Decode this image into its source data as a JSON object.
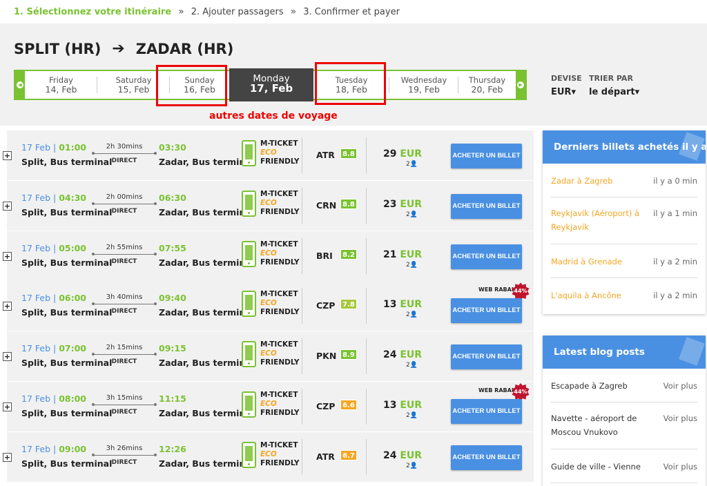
{
  "steps": [
    "1. Sélectionnez votre itinéraire",
    "2. Ajouter passagers",
    "3. Confirmer et payer"
  ],
  "step_separator": "»",
  "route": {
    "from": "SPLIT (HR)",
    "arrow": "➔",
    "to": "ZADAR (HR)"
  },
  "dates": [
    {
      "day": "Friday",
      "date": "14, Feb"
    },
    {
      "day": "Saturday",
      "date": "15, Feb"
    },
    {
      "day": "Sunday",
      "date": "16, Feb"
    },
    {
      "day": "Monday",
      "date": "17, Feb",
      "active": true
    },
    {
      "day": "Tuesday",
      "date": "18, Feb"
    },
    {
      "day": "Wednesday",
      "date": "19, Feb"
    },
    {
      "day": "Thursday",
      "date": "20, Feb"
    }
  ],
  "annotation": "autres dates de voyage",
  "options": {
    "devise_label": "DEVISE",
    "devise_value": "EUR▾",
    "trier_label": "TRIER PAR",
    "trier_value": "le départ▾"
  },
  "rows": [
    {
      "date": "17 Feb",
      "dep": "01:00",
      "dep_station": "Split, Bus terminal",
      "duration": "2h 30mins",
      "direct": "DIRECT",
      "arr": "03:30",
      "arr_station": "Zadar, Bus terminal",
      "operator": "ATR",
      "score": "8.8",
      "score_color": "#7ac231",
      "price": "29",
      "currency": "EUR",
      "pax": "2👤",
      "button": "ACHETER UN BILLET"
    },
    {
      "date": "17 Feb",
      "dep": "04:30",
      "dep_station": "Split, Bus terminal",
      "duration": "2h 00mins",
      "direct": "DIRECT",
      "arr": "06:30",
      "arr_station": "Zadar, Bus terminal",
      "operator": "CRN",
      "score": "8.8",
      "score_color": "#7ac231",
      "price": "23",
      "currency": "EUR",
      "pax": "2👤",
      "button": "ACHETER UN BILLET"
    },
    {
      "date": "17 Feb",
      "dep": "05:00",
      "dep_station": "Split, Bus terminal",
      "duration": "2h 55mins",
      "direct": "DIRECT",
      "arr": "07:55",
      "arr_station": "Zadar, Bus terminal",
      "operator": "BRI",
      "score": "8.2",
      "score_color": "#7ac231",
      "price": "21",
      "currency": "EUR",
      "pax": "2👤",
      "button": "ACHETER UN BILLET"
    },
    {
      "date": "17 Feb",
      "dep": "06:00",
      "dep_station": "Split, Bus terminal",
      "duration": "3h 40mins",
      "direct": "DIRECT",
      "arr": "09:40",
      "arr_station": "Zadar, Bus terminal",
      "operator": "CZP",
      "score": "7.8",
      "score_color": "#a6c83a",
      "price": "13",
      "currency": "EUR",
      "pax": "2👤",
      "button": "ACHETER UN BILLET",
      "promo": "WEB RABAIS",
      "discount": "44%"
    },
    {
      "date": "17 Feb",
      "dep": "07:00",
      "dep_station": "Split, Bus terminal",
      "duration": "2h 15mins",
      "direct": "DIRECT",
      "arr": "09:15",
      "arr_station": "Zadar, Bus terminal",
      "operator": "PKN",
      "score": "8.9",
      "score_color": "#7ac231",
      "price": "24",
      "currency": "EUR",
      "pax": "2👤",
      "button": "ACHETER UN BILLET"
    },
    {
      "date": "17 Feb",
      "dep": "08:00",
      "dep_station": "Split, Bus terminal",
      "duration": "3h 15mins",
      "direct": "DIRECT",
      "arr": "11:15",
      "arr_station": "Zadar, Bus terminal",
      "operator": "CZP",
      "score": "6.6",
      "score_color": "#f5a623",
      "price": "13",
      "currency": "EUR",
      "pax": "2👤",
      "button": "ACHETER UN BILLET",
      "promo": "WEB RABAIS",
      "discount": "44%"
    },
    {
      "date": "17 Feb",
      "dep": "09:00",
      "dep_station": "Split, Bus terminal",
      "duration": "3h 26mins",
      "direct": "DIRECT",
      "arr": "12:26",
      "arr_station": "Zadar, Bus terminal",
      "operator": "ATR",
      "score": "6.7",
      "score_color": "#f5a623",
      "price": "24",
      "currency": "EUR",
      "pax": "2👤",
      "button": "ACHETER UN BILLET"
    }
  ],
  "mticket": {
    "line1": "M-TICKET",
    "line2": "ECO",
    "line3": "FRIENDLY"
  },
  "panels": {
    "recent": {
      "title": "Derniers billets achetés il y a",
      "items": [
        {
          "route": "Zadar à Zagreb",
          "time": "il y a 0 min"
        },
        {
          "route": "Reykjavík (Aéroport) à Reykjavík",
          "time": "il y a 1 min"
        },
        {
          "route": "Madrid à Grenade",
          "time": "il y a 2 min"
        },
        {
          "route": "L'aquila à Ancône",
          "time": "il y a 2 min"
        }
      ]
    },
    "blog": {
      "title": "Latest blog posts",
      "items": [
        {
          "title": "Escapade à Zagreb",
          "link": "Voir plus"
        },
        {
          "title": "Navette - aéroport de Moscou Vnukovo",
          "link": "Voir plus"
        },
        {
          "title": "Guide de ville - Vienne",
          "link": "Voir plus"
        }
      ]
    }
  },
  "colors": {
    "green": "#7ac231",
    "blue": "#4a90e2",
    "red": "#e00000",
    "orange": "#f5a623"
  }
}
